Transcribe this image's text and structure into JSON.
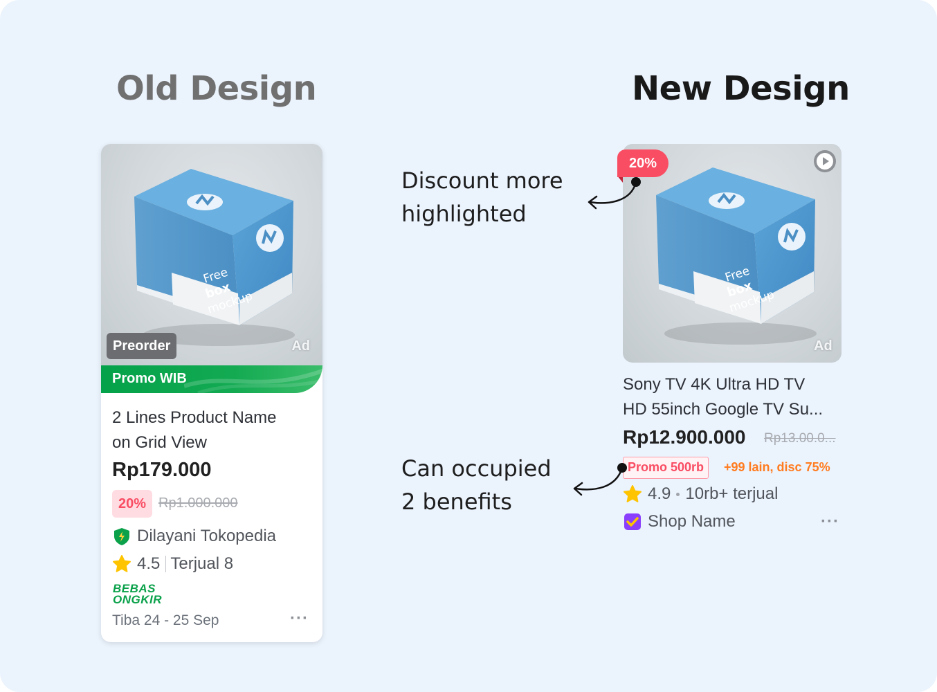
{
  "headings": {
    "old": "Old Design",
    "new": "New Design"
  },
  "old_card": {
    "preorder_label": "Preorder",
    "ad_label": "Ad",
    "promo_label": "Promo WIB",
    "name_line1": "2 Lines Product Name",
    "name_line2": "on Grid View",
    "price": "Rp179.000",
    "discount": "20%",
    "original_price": "Rp1.000.000",
    "fulfilled_by": "Dilayani Tokopedia",
    "rating": "4.5",
    "sold": "Terjual 8",
    "bebas_line1": "BEBAS",
    "bebas_line2": "ONGKIR",
    "delivery": "Tiba 24 - 25 Sep",
    "more": "···"
  },
  "new_card": {
    "discount": "20%",
    "ad_label": "Ad",
    "name_line1": "Sony TV 4K Ultra HD TV",
    "name_line2": "HD 55inch Google TV Su...",
    "price": "Rp12.900.000",
    "original_price": "Rp13.00.0...",
    "promo_label": "Promo 500rb",
    "extra_benefit": "+99 lain, disc 75%",
    "rating": "4.9",
    "sold": "10rb+ terjual",
    "shop_name": "Shop Name",
    "more": "···"
  },
  "box_text": {
    "line1": "Free",
    "line2": "box",
    "line3": "mockup",
    "site": "mockups-design.com"
  },
  "annotations": {
    "discount_line1": "Discount more",
    "discount_line2": "highlighted",
    "benefits_line1": "Can occupied",
    "benefits_line2": "2 benefits"
  },
  "colors": {
    "background": "#ebf3fd",
    "discount_red": "#f94d63",
    "promo_green": "#04a24a",
    "benefit_orange": "#ff7c1f",
    "star_yellow": "#ffc400",
    "shop_badge_purple": "#8a3ffc"
  },
  "icons": [
    "play-icon",
    "star-icon",
    "shield-icon",
    "shop-badge-icon",
    "more-icon"
  ]
}
